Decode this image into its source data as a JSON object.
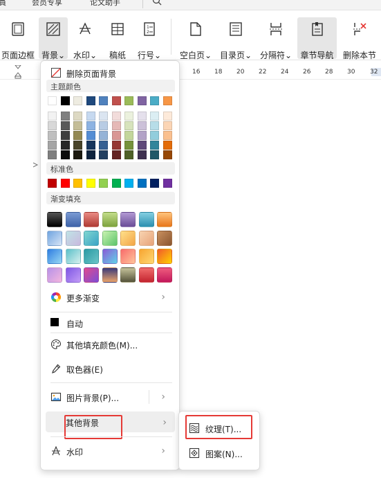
{
  "tabstrip": {
    "tabs": [
      "員",
      "会员专享",
      "论文助手"
    ],
    "search_icon": "search-icon"
  },
  "ribbon": {
    "buttons": [
      {
        "label": "页面边框",
        "icon": "page-border-icon"
      },
      {
        "label": "背景⌄",
        "icon": "background-icon",
        "active": true
      },
      {
        "label": "水印⌄",
        "icon": "watermark-icon"
      },
      {
        "label": "稿纸",
        "icon": "manuscript-paper-icon"
      },
      {
        "label": "行号⌄",
        "icon": "line-number-icon"
      },
      {
        "label": "空白页⌄",
        "icon": "blank-page-icon"
      },
      {
        "label": "目录页⌄",
        "icon": "toc-page-icon"
      },
      {
        "label": "分隔符⌄",
        "icon": "separator-icon"
      },
      {
        "label": "章节导航",
        "icon": "chapter-nav-icon",
        "active": true
      },
      {
        "label": "删除本节",
        "icon": "delete-section-icon"
      }
    ]
  },
  "ruler": {
    "numbers": [
      "16",
      "18",
      "20",
      "22",
      "24",
      "26",
      "28",
      "30",
      "32"
    ]
  },
  "menu": {
    "remove_bg": "删除页面背景",
    "theme_colors_header": "主题颜色",
    "theme_colors_top": [
      "#ffffff",
      "#000000",
      "#eeece1",
      "#1f497d",
      "#4f81bd",
      "#c0504d",
      "#9bbb59",
      "#8064a2",
      "#4bacc6",
      "#f79646"
    ],
    "theme_colors_shades": [
      [
        "#f2f2f2",
        "#7f7f7f",
        "#ddd9c3",
        "#c6d9f0",
        "#dbe5f1",
        "#f2dcdb",
        "#ebf1dd",
        "#e5e0ec",
        "#dbeef3",
        "#fdeada"
      ],
      [
        "#d8d8d8",
        "#595959",
        "#c4bd97",
        "#8db3e2",
        "#b8cce4",
        "#e5b9b7",
        "#d7e3bc",
        "#ccc1d9",
        "#b7dde8",
        "#fbd5b5"
      ],
      [
        "#bfbfbf",
        "#3f3f3f",
        "#938953",
        "#548dd4",
        "#95b3d7",
        "#d99694",
        "#c3d69b",
        "#b2a2c7",
        "#92cddc",
        "#fac08f"
      ],
      [
        "#a5a5a5",
        "#262626",
        "#494429",
        "#17365d",
        "#366092",
        "#953734",
        "#76923c",
        "#5f497a",
        "#31859b",
        "#e36c09"
      ],
      [
        "#7f7f7f",
        "#0c0c0c",
        "#1d1b10",
        "#0f243e",
        "#244061",
        "#632423",
        "#4f6128",
        "#3f3151",
        "#205867",
        "#974806"
      ]
    ],
    "standard_header": "标准色",
    "standard_colors": [
      "#c00000",
      "#ff0000",
      "#ffc000",
      "#ffff00",
      "#92d050",
      "#00b050",
      "#00b0f0",
      "#0070c0",
      "#002060",
      "#7030a0"
    ],
    "gradient_header": "渐变填充",
    "gradients": [
      [
        "linear-gradient(180deg,#555555,#000000)",
        "linear-gradient(180deg,#7a9bd4,#3e63a8)",
        "linear-gradient(180deg,#e98b84,#b03b34)",
        "linear-gradient(180deg,#c3dd8a,#7ea33e)",
        "linear-gradient(180deg,#b29ad3,#6a4d98)",
        "linear-gradient(180deg,#84cfe1,#2b8fb0)",
        "linear-gradient(180deg,#ffc37c,#e8761a)"
      ],
      [
        "linear-gradient(135deg,#6fa4e0,#d6e4f5)",
        "linear-gradient(135deg,#bfe3e6,#c9b9de)",
        "linear-gradient(135deg,#7fd6d0,#3aa3c6)",
        "linear-gradient(135deg,#c9f2b0,#5cc46a)",
        "linear-gradient(135deg,#ffe08a,#f3a547)",
        "linear-gradient(135deg,#f8d3b0,#e7a37a)",
        "linear-gradient(135deg,#c88f5e,#8a5630)"
      ],
      [
        "linear-gradient(135deg,#2f7de1,#97d8f4)",
        "linear-gradient(135deg,#5bc0c9,#d7f0ee)",
        "linear-gradient(135deg,#2a9aa4,#6cc4c7)",
        "linear-gradient(135deg,#8a5bd6,#61d2e8)",
        "linear-gradient(135deg,#f86b6b,#ffc59b)",
        "linear-gradient(135deg,#f7a531,#ffd874)",
        "linear-gradient(135deg,#f15a2b,#ffd200)"
      ],
      [
        "linear-gradient(135deg,#b792e8,#f4b6de)",
        "linear-gradient(135deg,#7e57e5,#c39cf6)",
        "linear-gradient(135deg,#e14b8c,#7c4ed8)",
        "linear-gradient(180deg,#3a3a7a,#e9a36a)",
        "linear-gradient(180deg,#c5c29a,#55533a)",
        "linear-gradient(180deg,#f06c6c,#c3242f)",
        "linear-gradient(180deg,#ef5b7e,#c2185b)"
      ]
    ],
    "more_gradient": "更多渐变",
    "auto": "自动",
    "auto_color": "#000000",
    "other_fill": "其他填充颜色(M)...",
    "eyedropper": "取色器(E)",
    "picture_bg": "图片背景(P)...",
    "other_bg": "其他背景",
    "watermark": "水印"
  },
  "submenu": {
    "texture": "纹理(T)...",
    "pattern": "图案(N)..."
  }
}
